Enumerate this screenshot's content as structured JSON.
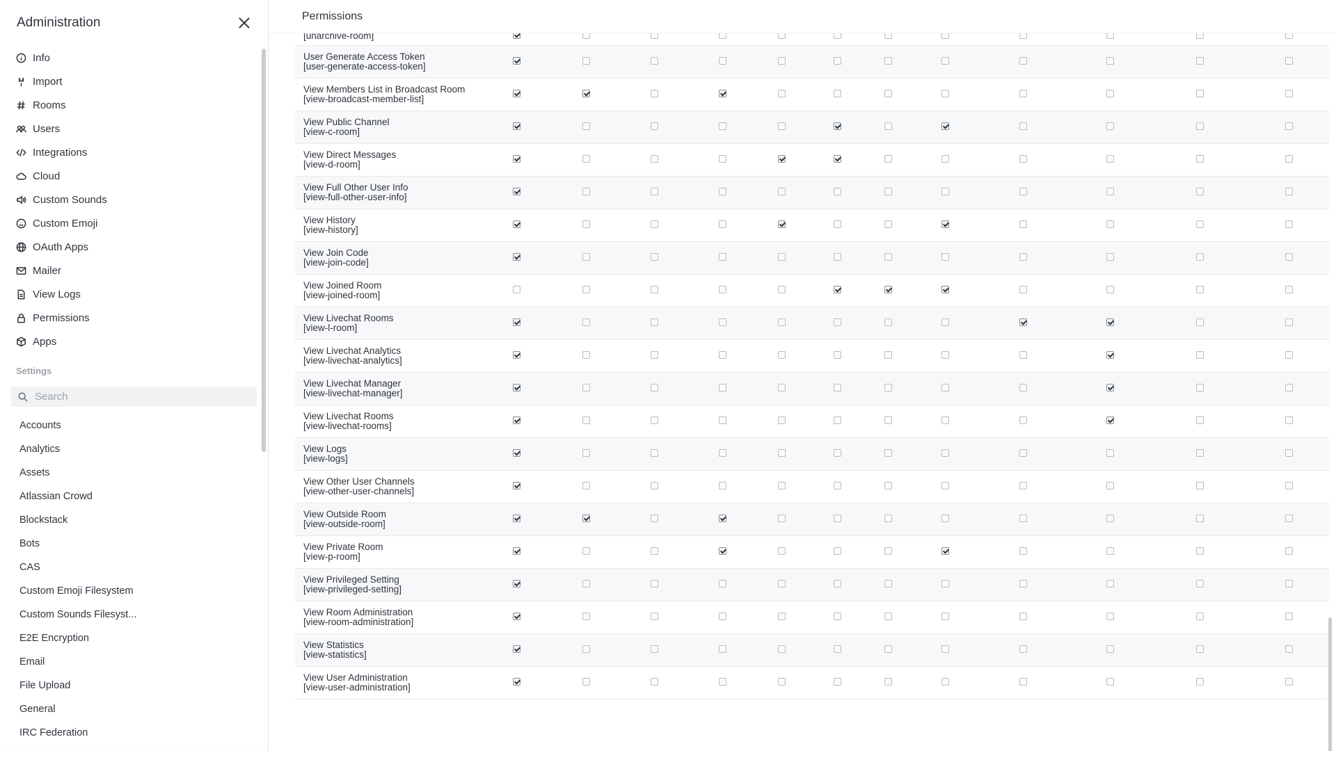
{
  "sidebar": {
    "title": "Administration",
    "nav": [
      {
        "label": "Info",
        "icon": "info-icon"
      },
      {
        "label": "Import",
        "icon": "import-icon"
      },
      {
        "label": "Rooms",
        "icon": "hashtag-icon"
      },
      {
        "label": "Users",
        "icon": "users-icon"
      },
      {
        "label": "Integrations",
        "icon": "code-icon"
      },
      {
        "label": "Cloud",
        "icon": "cloud-icon"
      },
      {
        "label": "Custom Sounds",
        "icon": "volume-icon"
      },
      {
        "label": "Custom Emoji",
        "icon": "emoji-icon"
      },
      {
        "label": "OAuth Apps",
        "icon": "globe-icon"
      },
      {
        "label": "Mailer",
        "icon": "mail-icon"
      },
      {
        "label": "View Logs",
        "icon": "document-icon"
      },
      {
        "label": "Permissions",
        "icon": "lock-icon"
      },
      {
        "label": "Apps",
        "icon": "cube-icon"
      }
    ],
    "settings_label": "Settings",
    "search_placeholder": "Search",
    "settings": [
      "Accounts",
      "Analytics",
      "Assets",
      "Atlassian Crowd",
      "Blockstack",
      "Bots",
      "CAS",
      "Custom Emoji Filesystem",
      "Custom Sounds Filesyst...",
      "E2E Encryption",
      "Email",
      "File Upload",
      "General",
      "IRC Federation"
    ]
  },
  "main": {
    "title": "Permissions",
    "rows": [
      {
        "name": "",
        "id": "[unarchive-room]",
        "checks": [
          1,
          0,
          0,
          0,
          0,
          0,
          0,
          0,
          0,
          0,
          0,
          0
        ]
      },
      {
        "name": "User Generate Access Token",
        "id": "[user-generate-access-token]",
        "checks": [
          1,
          0,
          0,
          0,
          0,
          0,
          0,
          0,
          0,
          0,
          0,
          0
        ]
      },
      {
        "name": "View Members List in Broadcast Room",
        "id": "[view-broadcast-member-list]",
        "checks": [
          1,
          1,
          0,
          1,
          0,
          0,
          0,
          0,
          0,
          0,
          0,
          0
        ]
      },
      {
        "name": "View Public Channel",
        "id": "[view-c-room]",
        "checks": [
          1,
          0,
          0,
          0,
          0,
          1,
          0,
          1,
          0,
          0,
          0,
          0
        ]
      },
      {
        "name": "View Direct Messages",
        "id": "[view-d-room]",
        "checks": [
          1,
          0,
          0,
          0,
          1,
          1,
          0,
          0,
          0,
          0,
          0,
          0
        ]
      },
      {
        "name": "View Full Other User Info",
        "id": "[view-full-other-user-info]",
        "checks": [
          1,
          0,
          0,
          0,
          0,
          0,
          0,
          0,
          0,
          0,
          0,
          0
        ]
      },
      {
        "name": "View History",
        "id": "[view-history]",
        "checks": [
          1,
          0,
          0,
          0,
          1,
          0,
          0,
          1,
          0,
          0,
          0,
          0
        ]
      },
      {
        "name": "View Join Code",
        "id": "[view-join-code]",
        "checks": [
          1,
          0,
          0,
          0,
          0,
          0,
          0,
          0,
          0,
          0,
          0,
          0
        ]
      },
      {
        "name": "View Joined Room",
        "id": "[view-joined-room]",
        "checks": [
          0,
          0,
          0,
          0,
          0,
          1,
          1,
          1,
          0,
          0,
          0,
          0
        ]
      },
      {
        "name": "View Livechat Rooms",
        "id": "[view-l-room]",
        "checks": [
          1,
          0,
          0,
          0,
          0,
          0,
          0,
          0,
          1,
          1,
          0,
          0
        ]
      },
      {
        "name": "View Livechat Analytics",
        "id": "[view-livechat-analytics]",
        "checks": [
          1,
          0,
          0,
          0,
          0,
          0,
          0,
          0,
          0,
          1,
          0,
          0
        ]
      },
      {
        "name": "View Livechat Manager",
        "id": "[view-livechat-manager]",
        "checks": [
          1,
          0,
          0,
          0,
          0,
          0,
          0,
          0,
          0,
          1,
          0,
          0
        ]
      },
      {
        "name": "View Livechat Rooms",
        "id": "[view-livechat-rooms]",
        "checks": [
          1,
          0,
          0,
          0,
          0,
          0,
          0,
          0,
          0,
          1,
          0,
          0
        ]
      },
      {
        "name": "View Logs",
        "id": "[view-logs]",
        "checks": [
          1,
          0,
          0,
          0,
          0,
          0,
          0,
          0,
          0,
          0,
          0,
          0
        ]
      },
      {
        "name": "View Other User Channels",
        "id": "[view-other-user-channels]",
        "checks": [
          1,
          0,
          0,
          0,
          0,
          0,
          0,
          0,
          0,
          0,
          0,
          0
        ]
      },
      {
        "name": "View Outside Room",
        "id": "[view-outside-room]",
        "checks": [
          1,
          1,
          0,
          1,
          0,
          0,
          0,
          0,
          0,
          0,
          0,
          0
        ]
      },
      {
        "name": "View Private Room",
        "id": "[view-p-room]",
        "checks": [
          1,
          0,
          0,
          1,
          0,
          0,
          0,
          1,
          0,
          0,
          0,
          0
        ]
      },
      {
        "name": "View Privileged Setting",
        "id": "[view-privileged-setting]",
        "checks": [
          1,
          0,
          0,
          0,
          0,
          0,
          0,
          0,
          0,
          0,
          0,
          0
        ]
      },
      {
        "name": "View Room Administration",
        "id": "[view-room-administration]",
        "checks": [
          1,
          0,
          0,
          0,
          0,
          0,
          0,
          0,
          0,
          0,
          0,
          0
        ]
      },
      {
        "name": "View Statistics",
        "id": "[view-statistics]",
        "checks": [
          1,
          0,
          0,
          0,
          0,
          0,
          0,
          0,
          0,
          0,
          0,
          0
        ]
      },
      {
        "name": "View User Administration",
        "id": "[view-user-administration]",
        "checks": [
          1,
          0,
          0,
          0,
          0,
          0,
          0,
          0,
          0,
          0,
          0,
          0
        ]
      }
    ]
  }
}
